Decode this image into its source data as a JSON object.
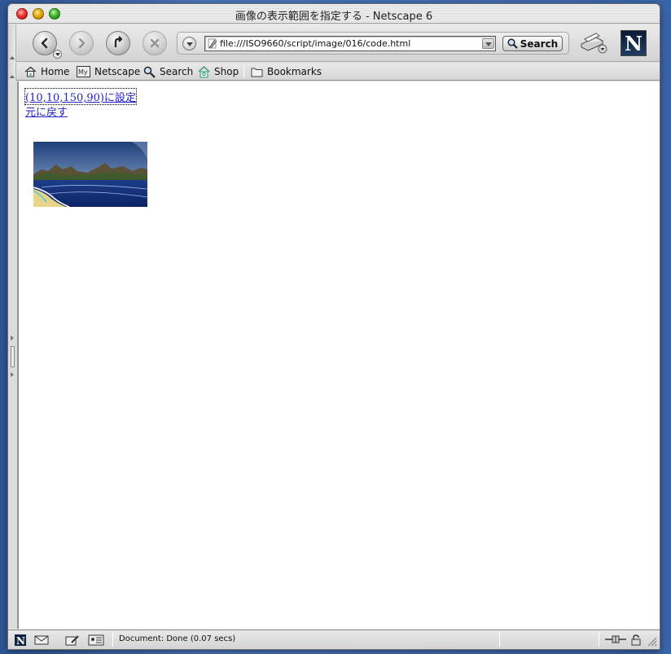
{
  "window": {
    "title": "画像の表示範囲を指定する - Netscape 6"
  },
  "navbar": {
    "url": "file:///ISO9660/script/image/016/code.html",
    "search_label": "Search",
    "logo_letter": "N"
  },
  "personal_toolbar": {
    "items": [
      {
        "label": "Home",
        "icon": "house-icon"
      },
      {
        "label": "Netscape",
        "icon": "my-netscape-icon"
      },
      {
        "label": "Search",
        "icon": "magnifier-icon"
      },
      {
        "label": "Shop",
        "icon": "shop-icon"
      },
      {
        "label": "Bookmarks",
        "icon": "folder-icon"
      }
    ]
  },
  "content": {
    "links": [
      {
        "label": "(10,10,150,90)に設定"
      },
      {
        "label": "元に戻す"
      }
    ],
    "image": {
      "alt_subject": "landscape-photo"
    }
  },
  "statusbar": {
    "text": "Document: Done (0.07 secs)"
  },
  "colors": {
    "link": "#2424c9",
    "desktop": "#3f66a8"
  }
}
